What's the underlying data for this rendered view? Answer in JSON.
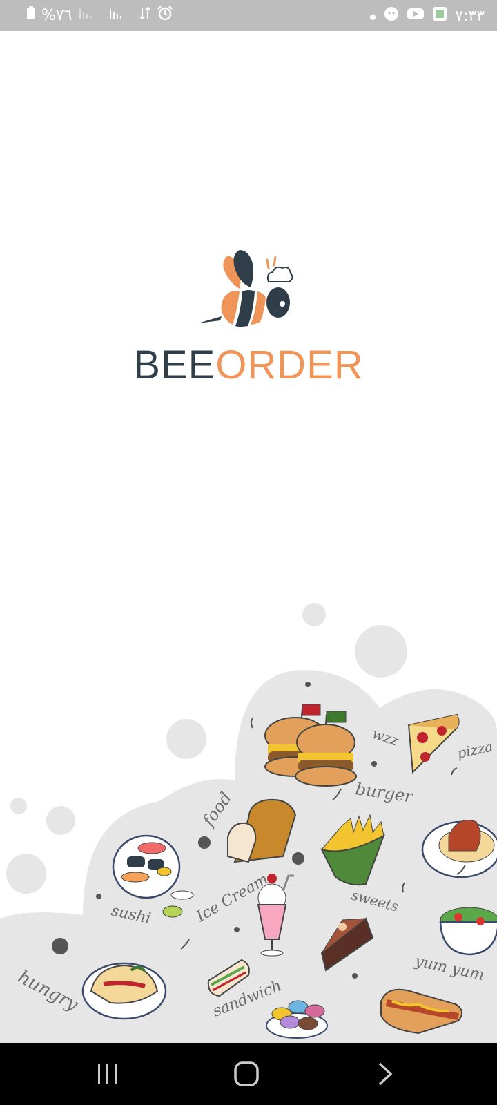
{
  "status_bar": {
    "battery_percent": "%٧٦",
    "time": "٧:٣٣",
    "left_icons": [
      "battery-icon",
      "signal-icon",
      "signal-icon",
      "data-arrows-icon",
      "alarm-icon"
    ],
    "right_icons": [
      "dot-icon",
      "face-icon",
      "youtube-icon",
      "app-notification-icon"
    ]
  },
  "brand": {
    "name_part1": "BEE",
    "name_part2": "ORDER",
    "accent_color": "#f0955a",
    "dark_color": "#2f3e48"
  },
  "illustration": {
    "labels": {
      "hungry": "hungry",
      "sushi": "sushi",
      "food": "food",
      "ice_cream": "Ice Cream",
      "sandwich": "sandwich",
      "burger": "burger",
      "wzz": "wzz",
      "pizza": "pizza",
      "sweets": "sweets",
      "yum_yum": "yum yum"
    }
  },
  "nav_bar": {
    "buttons": [
      "recent-apps-icon",
      "home-icon",
      "back-icon"
    ]
  }
}
